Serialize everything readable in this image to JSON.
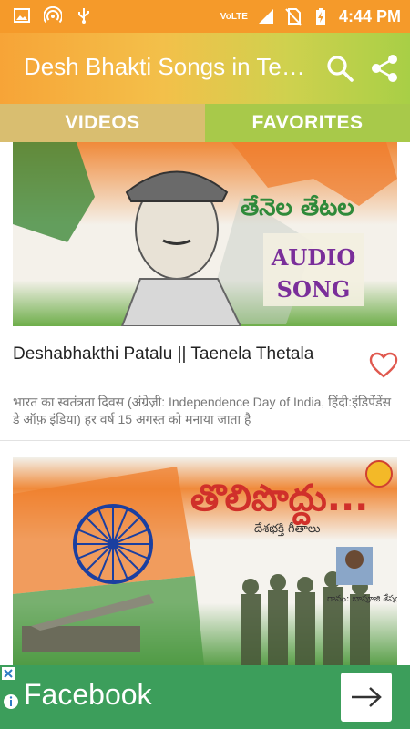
{
  "status": {
    "network_label": "VoLTE",
    "lte_label": "LTE",
    "time": "4:44 PM"
  },
  "app_bar": {
    "title": "Desh Bhakti Songs in Telugu",
    "search_icon": "search-icon",
    "share_icon": "share-icon"
  },
  "tabs": [
    {
      "label": "VIDEOS",
      "selected": true
    },
    {
      "label": "FAVORITES",
      "selected": false
    }
  ],
  "videos": [
    {
      "title": "Deshabhakthi Patalu || Taenela Thetala",
      "description": "भारत का स्वतंत्रता दिवस (अंग्रेज़ी: Independence Day of India, हिंदी:इंडिपेंडेंस डे ऑफ़ इंडिया) हर वर्ष 15 अगस्त को मनाया जाता है",
      "thumb_text_telugu": "తేనెల తేటల",
      "thumb_badge": "AUDIO SONG",
      "favorite_icon": "heart-outline-icon"
    },
    {
      "title_telugu": "తొలిపొద్దు...",
      "subtitle_telugu": "దేశభక్తి గీతాలు",
      "singer_telugu": "గానం: బాపూజి శేషయ్య"
    }
  ],
  "ad": {
    "text": "Facebook",
    "info_icon": "info-icon",
    "close_icon": "close-icon",
    "arrow_icon": "arrow-right-icon"
  },
  "colors": {
    "status_bar": "#f59a2a",
    "tab_videos": "#d9be70",
    "tab_favorites": "#a8c94a",
    "ad_bar": "#3c9e5b",
    "heart": "#e0594f"
  }
}
